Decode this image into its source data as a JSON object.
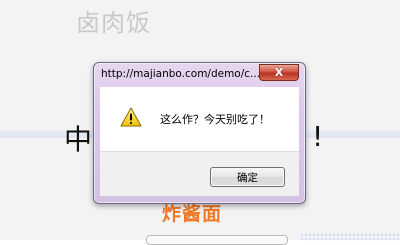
{
  "background": {
    "title": "卤肉饭",
    "line_left": "中",
    "line_right": "!",
    "brand": "炸酱面"
  },
  "dialog": {
    "title": "http://majianbo.com/demo/c...",
    "close_label": "X",
    "message": "这么作？今天别吃了！",
    "ok_label": "确定",
    "icon": "warning-icon"
  }
}
